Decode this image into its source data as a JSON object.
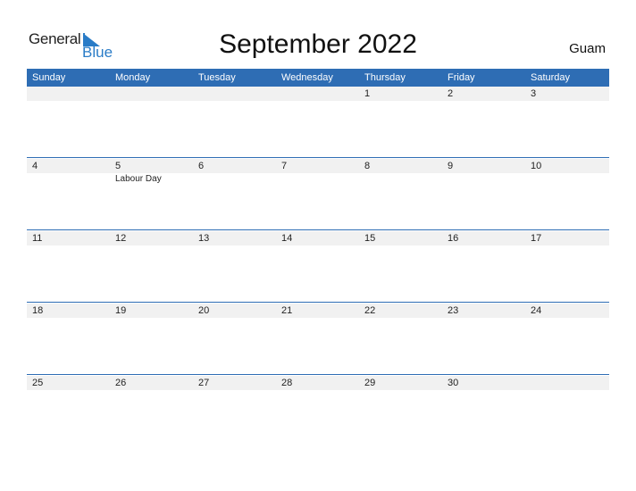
{
  "logo": {
    "text_general": "General",
    "text_blue": "Blue",
    "brand_color": "#2a7cc7"
  },
  "title": "September 2022",
  "region": "Guam",
  "header_color": "#2e6db4",
  "weekdays": [
    "Sunday",
    "Monday",
    "Tuesday",
    "Wednesday",
    "Thursday",
    "Friday",
    "Saturday"
  ],
  "weeks": [
    {
      "days": [
        {
          "num": "",
          "event": ""
        },
        {
          "num": "",
          "event": ""
        },
        {
          "num": "",
          "event": ""
        },
        {
          "num": "",
          "event": ""
        },
        {
          "num": "1",
          "event": ""
        },
        {
          "num": "2",
          "event": ""
        },
        {
          "num": "3",
          "event": ""
        }
      ]
    },
    {
      "days": [
        {
          "num": "4",
          "event": ""
        },
        {
          "num": "5",
          "event": "Labour Day"
        },
        {
          "num": "6",
          "event": ""
        },
        {
          "num": "7",
          "event": ""
        },
        {
          "num": "8",
          "event": ""
        },
        {
          "num": "9",
          "event": ""
        },
        {
          "num": "10",
          "event": ""
        }
      ]
    },
    {
      "days": [
        {
          "num": "11",
          "event": ""
        },
        {
          "num": "12",
          "event": ""
        },
        {
          "num": "13",
          "event": ""
        },
        {
          "num": "14",
          "event": ""
        },
        {
          "num": "15",
          "event": ""
        },
        {
          "num": "16",
          "event": ""
        },
        {
          "num": "17",
          "event": ""
        }
      ]
    },
    {
      "days": [
        {
          "num": "18",
          "event": ""
        },
        {
          "num": "19",
          "event": ""
        },
        {
          "num": "20",
          "event": ""
        },
        {
          "num": "21",
          "event": ""
        },
        {
          "num": "22",
          "event": ""
        },
        {
          "num": "23",
          "event": ""
        },
        {
          "num": "24",
          "event": ""
        }
      ]
    },
    {
      "days": [
        {
          "num": "25",
          "event": ""
        },
        {
          "num": "26",
          "event": ""
        },
        {
          "num": "27",
          "event": ""
        },
        {
          "num": "28",
          "event": ""
        },
        {
          "num": "29",
          "event": ""
        },
        {
          "num": "30",
          "event": ""
        },
        {
          "num": "",
          "event": ""
        }
      ]
    }
  ]
}
